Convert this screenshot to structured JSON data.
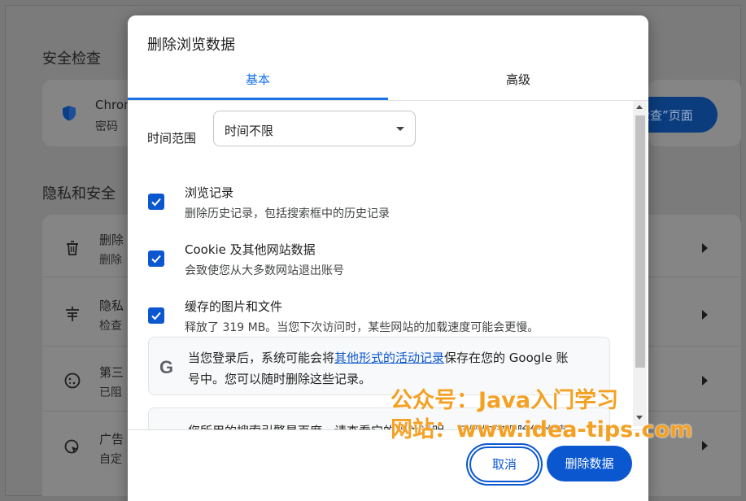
{
  "background": {
    "safety_check": {
      "title": "安全检查",
      "item_title": "Chron",
      "item_sub": "密码",
      "button_label": "检查”页面"
    },
    "privacy": {
      "title": "隐私和安全",
      "items": [
        {
          "icon": "trash-icon",
          "title": "删除",
          "sub": "删除"
        },
        {
          "icon": "privacy-guide-icon",
          "title": "隐私",
          "sub": "检查"
        },
        {
          "icon": "cookie-icon",
          "title": "第三",
          "sub": "已阻"
        },
        {
          "icon": "ad-privacy-icon",
          "title": "广告",
          "sub": "自定"
        }
      ]
    }
  },
  "dialog": {
    "title": "删除浏览数据",
    "tabs": [
      {
        "label": "基本",
        "active": true
      },
      {
        "label": "高级",
        "active": false
      }
    ],
    "time_range": {
      "label": "时间范围",
      "value": "时间不限"
    },
    "options": [
      {
        "title": "浏览记录",
        "desc": "删除历史记录，包括搜索框中的历史记录",
        "checked": true
      },
      {
        "title": "Cookie 及其他网站数据",
        "desc": "会致使您从大多数网站退出账号",
        "checked": true
      },
      {
        "title": "缓存的图片和文件",
        "desc": "释放了 319 MB。当您下次访问时，某些网站的加载速度可能会更慢。",
        "checked": true
      }
    ],
    "google_info": {
      "icon": "G",
      "prefix": "当您登录后，系统可能会将",
      "link": "其他形式的活动记录",
      "suffix": "保存在您的 Google 账",
      "line2": "号中。您可以随时删除这些记录。"
    },
    "search_info": {
      "line1": "您所用的搜索引擎是百度。请查看它的相关说明，了解如何删除您的搜"
    },
    "buttons": {
      "cancel": "取消",
      "delete": "删除数据"
    }
  },
  "watermark": {
    "line1": "公众号：Java入门学习",
    "line2": "网站：www.idea-tips.com"
  },
  "colors": {
    "accent": "#0b57d0",
    "tab_active": "#1a73e8",
    "watermark": "#f4a023"
  }
}
